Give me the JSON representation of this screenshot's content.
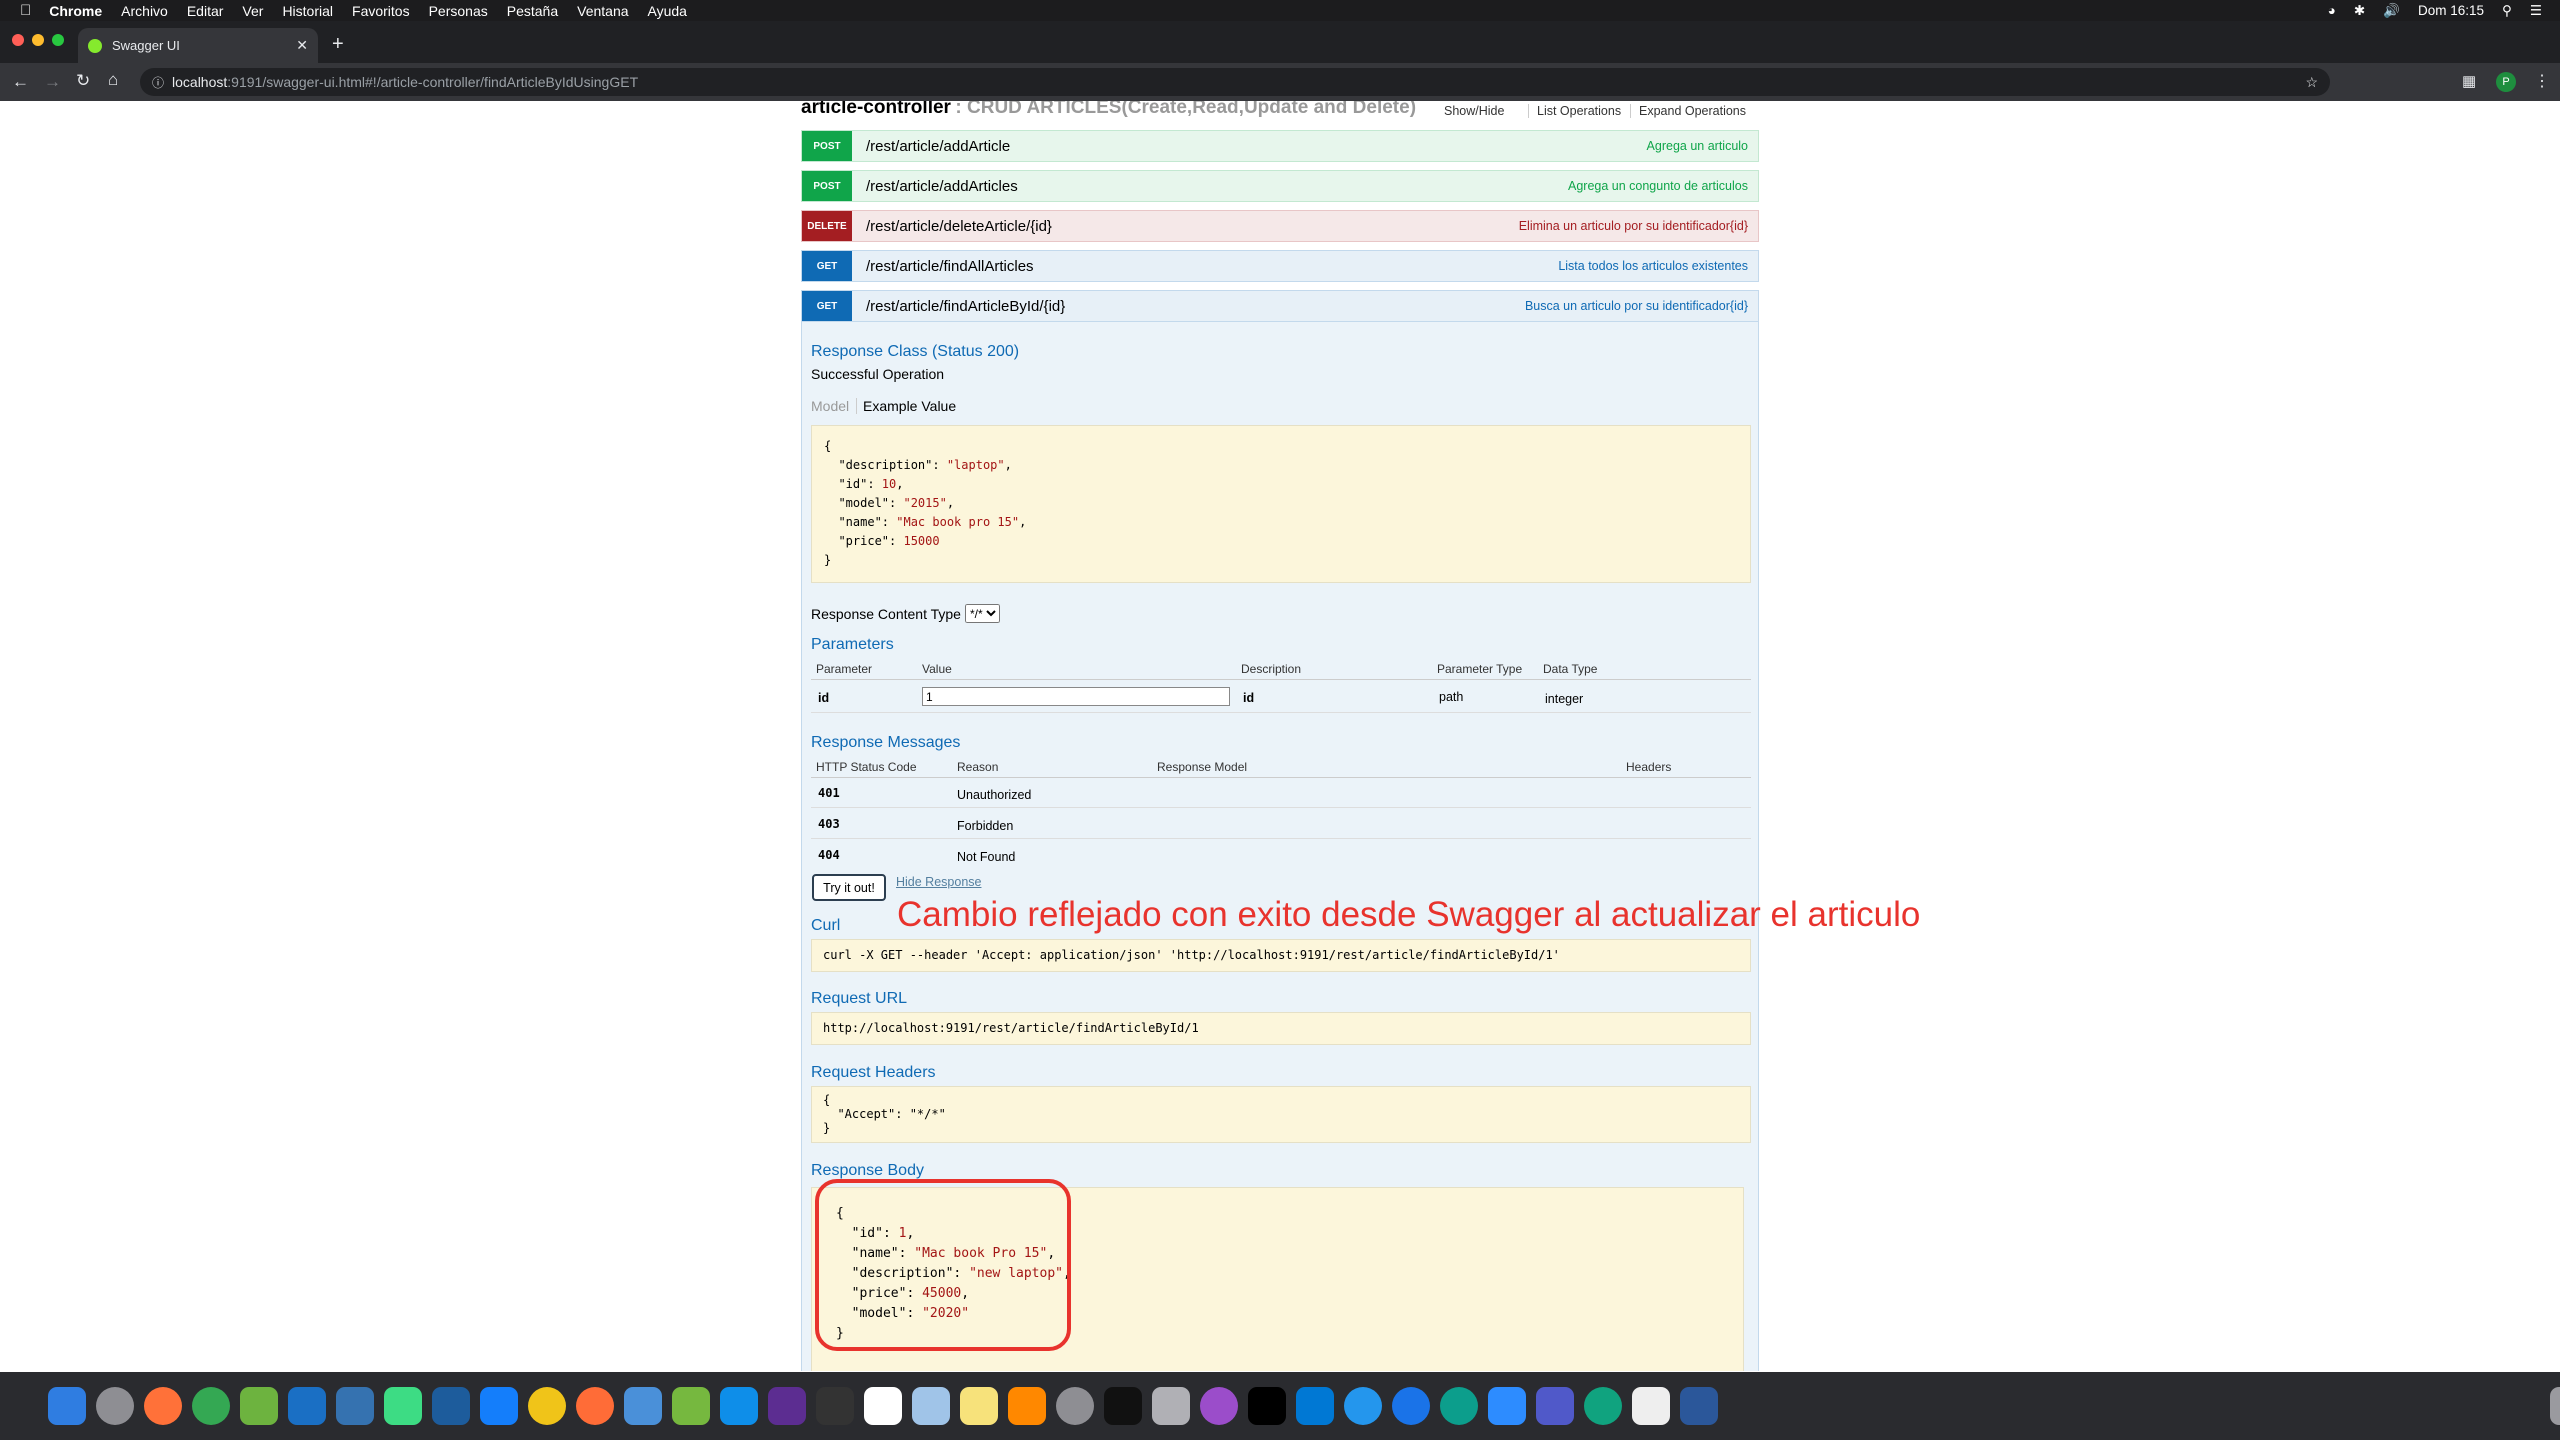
{
  "menubar": {
    "items": [
      "Chrome",
      "Archivo",
      "Editar",
      "Ver",
      "Historial",
      "Favoritos",
      "Personas",
      "Pestaña",
      "Ventana",
      "Ayuda"
    ],
    "clock": "Dom 16:15"
  },
  "browser": {
    "tab_title": "Swagger UI",
    "url_host": "localhost",
    "url_rest": ":9191/swagger-ui.html#!/article-controller/findArticleByIdUsingGET",
    "profile_initial": "P"
  },
  "swagger": {
    "controller_name": "article-controller",
    "controller_desc": ": CRUD ARTICLES(Create,Read,Update and Delete)",
    "header_links": [
      "Show/Hide",
      "List Operations",
      "Expand Operations"
    ],
    "operations": [
      {
        "method": "POST",
        "path": "/rest/article/addArticle",
        "summary": "Agrega un articulo"
      },
      {
        "method": "POST",
        "path": "/rest/article/addArticles",
        "summary": "Agrega un congunto de articulos"
      },
      {
        "method": "DELETE",
        "path": "/rest/article/deleteArticle/{id}",
        "summary": "Elimina un articulo por su identificador{id}"
      },
      {
        "method": "GET",
        "path": "/rest/article/findAllArticles",
        "summary": "Lista todos los articulos existentes"
      },
      {
        "method": "GET",
        "path": "/rest/article/findArticleById/{id}",
        "summary": "Busca un articulo por su identificador{id}"
      }
    ],
    "response_class_title": "Response Class (Status 200)",
    "response_class_desc": "Successful Operation",
    "model_tab": "Model",
    "example_tab": "Example Value",
    "example_lines": [
      "{",
      "  \"description\": \"laptop\",",
      "  \"id\": 10,",
      "  \"model\": \"2015\",",
      "  \"name\": \"Mac book pro 15\",",
      "  \"price\": 15000",
      "}"
    ],
    "content_type_label": "Response Content Type",
    "content_type_value": "*/*",
    "parameters_title": "Parameters",
    "param_headers": [
      "Parameter",
      "Value",
      "Description",
      "Parameter Type",
      "Data Type"
    ],
    "param_row": {
      "name": "id",
      "value": "1",
      "description": "id",
      "type": "path",
      "data_type": "integer"
    },
    "messages_title": "Response Messages",
    "message_headers": [
      "HTTP Status Code",
      "Reason",
      "Response Model",
      "Headers"
    ],
    "messages": [
      {
        "code": "401",
        "reason": "Unauthorized"
      },
      {
        "code": "403",
        "reason": "Forbidden"
      },
      {
        "code": "404",
        "reason": "Not Found"
      }
    ],
    "try_button": "Try it out!",
    "hide_response": "Hide Response",
    "annotation": "Cambio reflejado con exito desde Swagger al actualizar el articulo",
    "curl_title": "Curl",
    "curl_text": "curl -X GET --header 'Accept: application/json' 'http://localhost:9191/rest/article/findArticleById/1'",
    "request_url_title": "Request URL",
    "request_url": "http://localhost:9191/rest/article/findArticleById/1",
    "request_headers_title": "Request Headers",
    "request_headers_lines": [
      "{",
      "  \"Accept\": \"*/*\"",
      "}"
    ],
    "response_body_title": "Response Body",
    "response_body_lines": [
      "{",
      "  \"id\": 1,",
      "  \"name\": \"Mac book Pro 15\",",
      "  \"description\": \"new laptop\",",
      "  \"price\": 45000,",
      "  \"model\": \"2020\"",
      "}"
    ]
  },
  "colors": {
    "post": "#10a54a",
    "delete": "#a41e22",
    "get": "#0f6ab4",
    "annotation": "#e8332d",
    "json_string": "#a31515"
  }
}
